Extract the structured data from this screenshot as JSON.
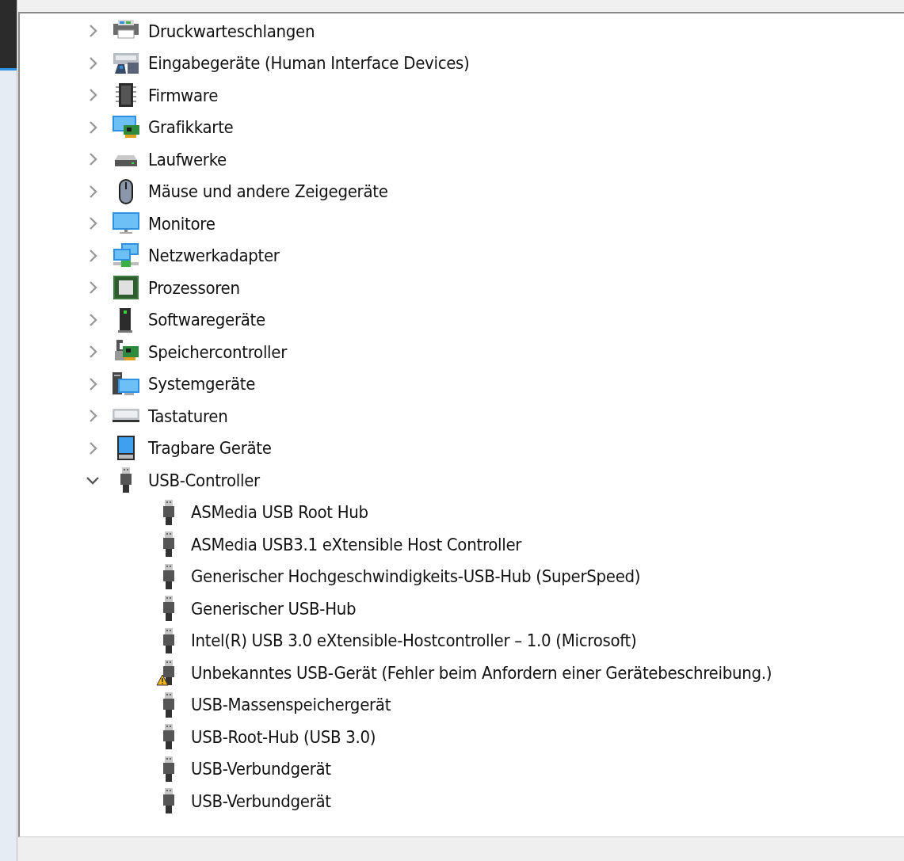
{
  "device_tree": {
    "items": [
      {
        "label": "Druckwarteschlangen",
        "expanded": false
      },
      {
        "label": "Eingabegeräte (Human Interface Devices)",
        "expanded": false
      },
      {
        "label": "Firmware",
        "expanded": false
      },
      {
        "label": "Grafikkarte",
        "expanded": false
      },
      {
        "label": "Laufwerke",
        "expanded": false
      },
      {
        "label": "Mäuse und andere Zeigegeräte",
        "expanded": false
      },
      {
        "label": "Monitore",
        "expanded": false
      },
      {
        "label": "Netzwerkadapter",
        "expanded": false
      },
      {
        "label": "Prozessoren",
        "expanded": false
      },
      {
        "label": "Softwaregeräte",
        "expanded": false
      },
      {
        "label": "Speichercontroller",
        "expanded": false
      },
      {
        "label": "Systemgeräte",
        "expanded": false
      },
      {
        "label": "Tastaturen",
        "expanded": false
      },
      {
        "label": "Tragbare Geräte",
        "expanded": false
      },
      {
        "label": "USB-Controller",
        "expanded": true,
        "children": [
          {
            "label": "ASMedia USB Root Hub",
            "warning": false
          },
          {
            "label": "ASMedia USB3.1 eXtensible Host Controller",
            "warning": false
          },
          {
            "label": "Generischer Hochgeschwindigkeits-USB-Hub (SuperSpeed)",
            "warning": false
          },
          {
            "label": "Generischer USB-Hub",
            "warning": false
          },
          {
            "label": "Intel(R) USB 3.0 eXtensible-Hostcontroller – 1.0 (Microsoft)",
            "warning": false
          },
          {
            "label": "Unbekanntes USB-Gerät (Fehler beim Anfordern einer Gerätebeschreibung.)",
            "warning": true
          },
          {
            "label": "USB-Massenspeichergerät",
            "warning": false
          },
          {
            "label": "USB-Root-Hub (USB 3.0)",
            "warning": false
          },
          {
            "label": "USB-Verbundgerät",
            "warning": false
          },
          {
            "label": "USB-Verbundgerät",
            "warning": false
          }
        ]
      }
    ]
  }
}
